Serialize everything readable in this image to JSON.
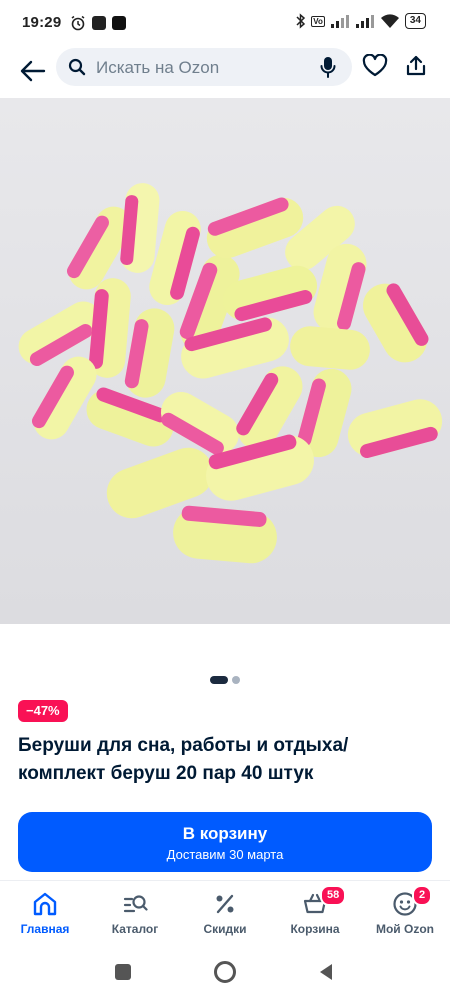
{
  "status": {
    "time": "19:29",
    "battery": "34"
  },
  "search": {
    "placeholder": "Искать на Ozon"
  },
  "product": {
    "discount": "−47%",
    "title": "Беруши для сна, работы и отдыха/ комплект беруш 20 пар 40 штук",
    "image_count": 2,
    "image_active_index": 0
  },
  "cart_button": {
    "label": "В корзину",
    "delivery": "Доставим 30 марта"
  },
  "nav": {
    "items": [
      {
        "label": "Главная",
        "icon": "home-icon",
        "active": true
      },
      {
        "label": "Каталог",
        "icon": "catalog-search-icon"
      },
      {
        "label": "Скидки",
        "icon": "percent-icon"
      },
      {
        "label": "Корзина",
        "icon": "cart-icon",
        "badge": "58"
      },
      {
        "label": "Мой Ozon",
        "icon": "profile-smile-icon",
        "badge": "2"
      }
    ]
  },
  "colors": {
    "accent": "#005bff",
    "badge": "#f91155",
    "text": "#001a34"
  }
}
